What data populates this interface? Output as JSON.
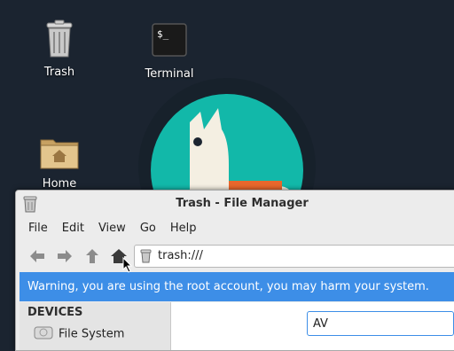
{
  "desktop": {
    "icons": [
      {
        "label": "Trash",
        "icon": "trash-icon"
      },
      {
        "label": "Terminal",
        "icon": "terminal-icon"
      },
      {
        "label": "Home",
        "icon": "home-folder-icon"
      }
    ],
    "colors": {
      "background": "#1b2430",
      "logo_teal": "#12b8a9",
      "accent": "#3d8ee7"
    }
  },
  "window": {
    "title": "Trash - File Manager",
    "menu": [
      "File",
      "Edit",
      "View",
      "Go",
      "Help"
    ],
    "toolbar": {
      "back": "back-arrow-icon",
      "forward": "forward-arrow-icon",
      "up": "up-arrow-icon",
      "home": "home-icon"
    },
    "location": {
      "value": "trash:///"
    },
    "warning": "Warning, you are using the root account, you may harm your system.",
    "sidebar": {
      "header": "DEVICES",
      "items": [
        {
          "label": "File System",
          "icon": "drive-icon"
        }
      ]
    },
    "search": {
      "value": "AV"
    }
  }
}
